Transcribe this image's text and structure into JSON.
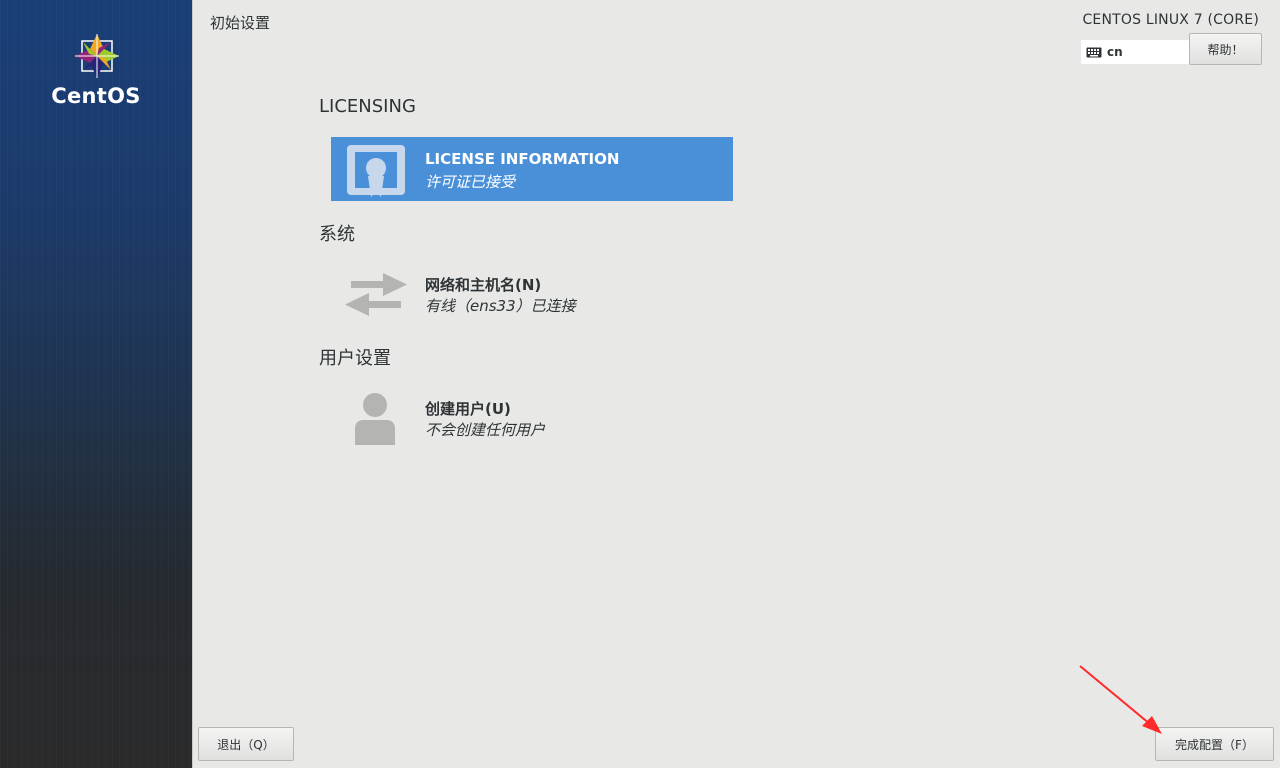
{
  "sidebar": {
    "logo_text": "CentOS"
  },
  "header": {
    "title": "初始设置",
    "product_name": "CENTOS LINUX 7 (CORE)",
    "keyboard_layout": "cn",
    "help_label": "帮助！"
  },
  "sections": {
    "licensing": {
      "heading": "LICENSING",
      "spoke": {
        "title": "LICENSE INFORMATION",
        "status": "许可证已接受",
        "icon": "license-certificate-icon"
      }
    },
    "system": {
      "heading": "系统",
      "spoke": {
        "title": "网络和主机名(N)",
        "status": "有线（ens33）已连接",
        "icon": "network-arrows-icon"
      }
    },
    "user_settings": {
      "heading": "用户设置",
      "spoke": {
        "title": "创建用户(U)",
        "status": "不会创建任何用户",
        "icon": "user-icon"
      }
    }
  },
  "footer": {
    "quit_label": "退出（Q）",
    "finish_label": "完成配置（F）"
  },
  "colors": {
    "sidebar_top": "#1a3e78",
    "sidebar_bottom": "#2a2a2a",
    "selected_spoke": "#4a90d9",
    "background": "#e8e8e7",
    "annotation_arrow": "#ff2a2a"
  }
}
